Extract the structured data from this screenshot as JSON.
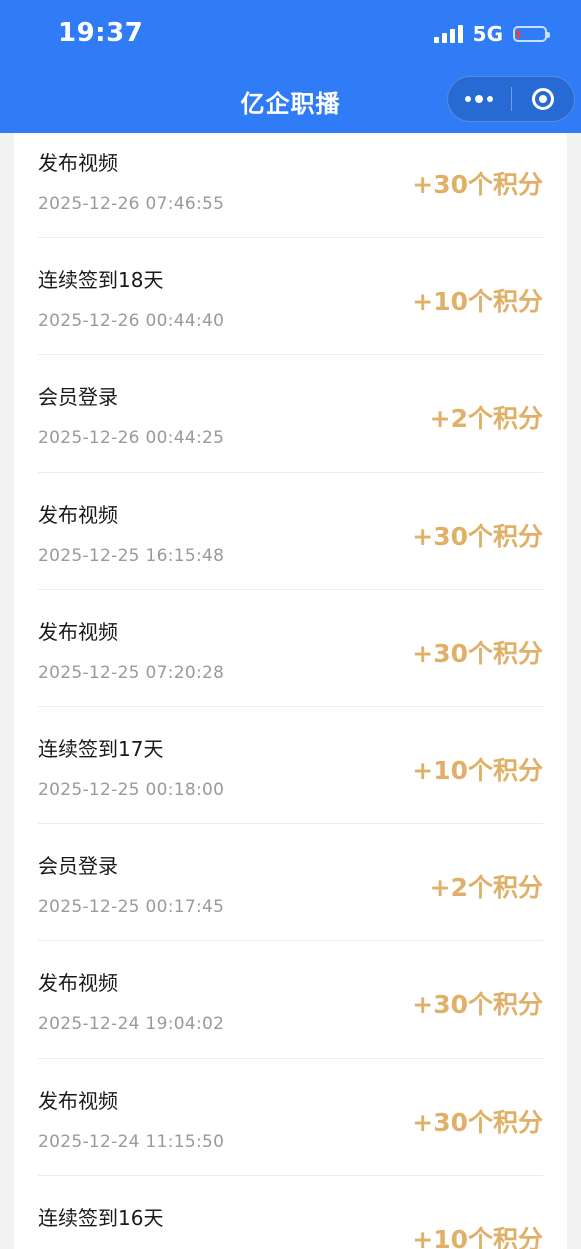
{
  "status_bar": {
    "time": "19:37",
    "network": "5G",
    "battery_level": 0.1
  },
  "nav": {
    "title": "亿企职播",
    "more_icon": "more-dots-icon",
    "close_icon": "target-circle-icon"
  },
  "colors": {
    "header_bg": "#2f7cf6",
    "points": "#e0b068",
    "battery_low": "#ff3b30"
  },
  "records": [
    {
      "title": "发布视频",
      "time": "2025-12-26 07:46:55",
      "points": "+30个积分"
    },
    {
      "title": "连续签到18天",
      "time": "2025-12-26 00:44:40",
      "points": "+10个积分"
    },
    {
      "title": "会员登录",
      "time": "2025-12-26 00:44:25",
      "points": "+2个积分"
    },
    {
      "title": "发布视频",
      "time": "2025-12-25 16:15:48",
      "points": "+30个积分"
    },
    {
      "title": "发布视频",
      "time": "2025-12-25 07:20:28",
      "points": "+30个积分"
    },
    {
      "title": "连续签到17天",
      "time": "2025-12-25 00:18:00",
      "points": "+10个积分"
    },
    {
      "title": "会员登录",
      "time": "2025-12-25 00:17:45",
      "points": "+2个积分"
    },
    {
      "title": "发布视频",
      "time": "2025-12-24 19:04:02",
      "points": "+30个积分"
    },
    {
      "title": "发布视频",
      "time": "2025-12-24 11:15:50",
      "points": "+30个积分"
    },
    {
      "title": "连续签到16天",
      "time": "",
      "points": "+10个积分"
    }
  ]
}
